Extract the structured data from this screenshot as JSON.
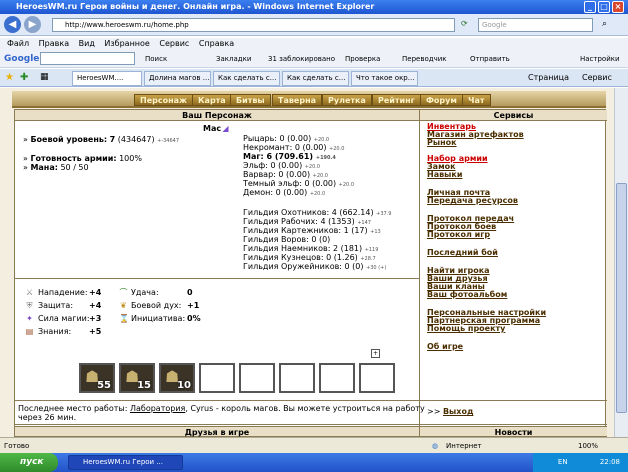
{
  "window": {
    "title": "HeroesWM.ru Герои войны и денег. Онлайн игра. - Windows Internet Explorer"
  },
  "address": {
    "url": "http://www.heroeswm.ru/home.php",
    "search_placeholder": "Google"
  },
  "menu": [
    "Файл",
    "Правка",
    "Вид",
    "Избранное",
    "Сервис",
    "Справка"
  ],
  "google_bar": {
    "logo": "Google",
    "search_label": "Поиск",
    "bookmarks": "Закладки",
    "blocked": "31 заблокировано",
    "spell": "Проверка",
    "translator": "Переводчик",
    "send": "Отправить",
    "settings": "Настройки"
  },
  "tabs": [
    "HeroesWM....",
    "Долина магов ...",
    "Как сделать с...",
    "Как сделать с...",
    "Что такое окр..."
  ],
  "ie_tools": {
    "page": "Страница",
    "service": "Сервис"
  },
  "game_nav": [
    "Персонаж",
    "Карта",
    "Битвы",
    "Таверна",
    "Рулетка",
    "Рейтинг",
    "Форум",
    "Чат"
  ],
  "character": {
    "header": "Ваш Персонаж",
    "name": "Мас",
    "level_label": "Боевой уровень:",
    "level": "7",
    "level_exp": "(434647)",
    "level_delta": "+-34647",
    "army_label": "Готовность армии:",
    "army": "100%",
    "mana_label": "Мана:",
    "mana": "50 / 50",
    "guilds": [
      {
        "name": "Рыцарь:",
        "value": "0 (0.00)",
        "delta": "+20.0"
      },
      {
        "name": "Некромант:",
        "value": "0 (0.00)",
        "delta": "+20.0"
      },
      {
        "name": "Маг: 6",
        "value": "(709.61)",
        "delta": "+190.4",
        "bold": true
      },
      {
        "name": "Эльф:",
        "value": "0 (0.00)",
        "delta": "+20.0"
      },
      {
        "name": "Варвар:",
        "value": "0 (0.00)",
        "delta": "+20.0"
      },
      {
        "name": "Темный эльф:",
        "value": "0 (0.00)",
        "delta": "+20.0"
      },
      {
        "name": "Демон:",
        "value": "0 (0.00)",
        "delta": "+20.0"
      }
    ],
    "guilds2": [
      {
        "name": "Гильдия Охотников:",
        "value": "4 (662.14)",
        "delta": "+37.9"
      },
      {
        "name": "Гильдия Рабочих:",
        "value": "4 (1353)",
        "delta": "+147"
      },
      {
        "name": "Гильдия Картежников:",
        "value": "1 (17)",
        "delta": "+13"
      },
      {
        "name": "Гильдия Воров:",
        "value": "0 (0)",
        "delta": ""
      },
      {
        "name": "Гильдия Наемников:",
        "value": "2 (181)",
        "delta": "+119"
      },
      {
        "name": "Гильдия Кузнецов:",
        "value": "0 (1.26)",
        "delta": "+28.7"
      },
      {
        "name": "Гильдия Оружейников:",
        "value": "0 (0)",
        "delta": "+30 (+)"
      }
    ],
    "stats_left": [
      {
        "label": "Нападение:",
        "value": "+4"
      },
      {
        "label": "Защита:",
        "value": "+4"
      },
      {
        "label": "Сила магии:",
        "value": "+3"
      },
      {
        "label": "Знания:",
        "value": "+5"
      }
    ],
    "stats_right": [
      {
        "label": "Удача:",
        "value": "0"
      },
      {
        "label": "Боевой дух:",
        "value": "+1"
      },
      {
        "label": "Инициатива:",
        "value": "0%"
      }
    ],
    "slots": [
      "55",
      "15",
      "10",
      "",
      "",
      "",
      "",
      ""
    ],
    "last_work_prefix": "Последнее место работы:",
    "last_work_place": "Лаборатория",
    "last_work_suffix": ", Cyrus - король магов. Вы можете устроиться на работу",
    "last_work_time": "через 26 мин."
  },
  "services": {
    "header": "Сервисы",
    "items": [
      {
        "label": "Инвентарь",
        "red": true
      },
      {
        "label": "Магазин артефактов"
      },
      {
        "label": "Рынок"
      },
      {
        "label": "Набор армии",
        "red": true
      },
      {
        "label": "Замок"
      },
      {
        "label": "Навыки"
      },
      {
        "label": "Личная почта"
      },
      {
        "label": "Передача ресурсов"
      },
      {
        "label": "Протокол передач"
      },
      {
        "label": "Протокол боев"
      },
      {
        "label": "Протокол игр"
      },
      {
        "label": "Последний бой"
      },
      {
        "label": "Найти игрока"
      },
      {
        "label": "Ваши друзья"
      },
      {
        "label": "Ваши кланы"
      },
      {
        "label": "Ваш фотоальбом"
      },
      {
        "label": "Персональные настройки"
      },
      {
        "label": "Партнерская программа"
      },
      {
        "label": "Помощь проекту"
      },
      {
        "label": "Об игре"
      }
    ],
    "exit_prefix": ">>",
    "exit": "Выход"
  },
  "bottom": {
    "friends": "Друзья в игре",
    "news": "Новости"
  },
  "status": {
    "left": "Готово",
    "zone": "Интернет",
    "zoom": "100%"
  },
  "taskbar": {
    "start": "пуск",
    "item": "HeroesWM.ru Герои ...",
    "lang": "EN",
    "time": "22:08"
  }
}
